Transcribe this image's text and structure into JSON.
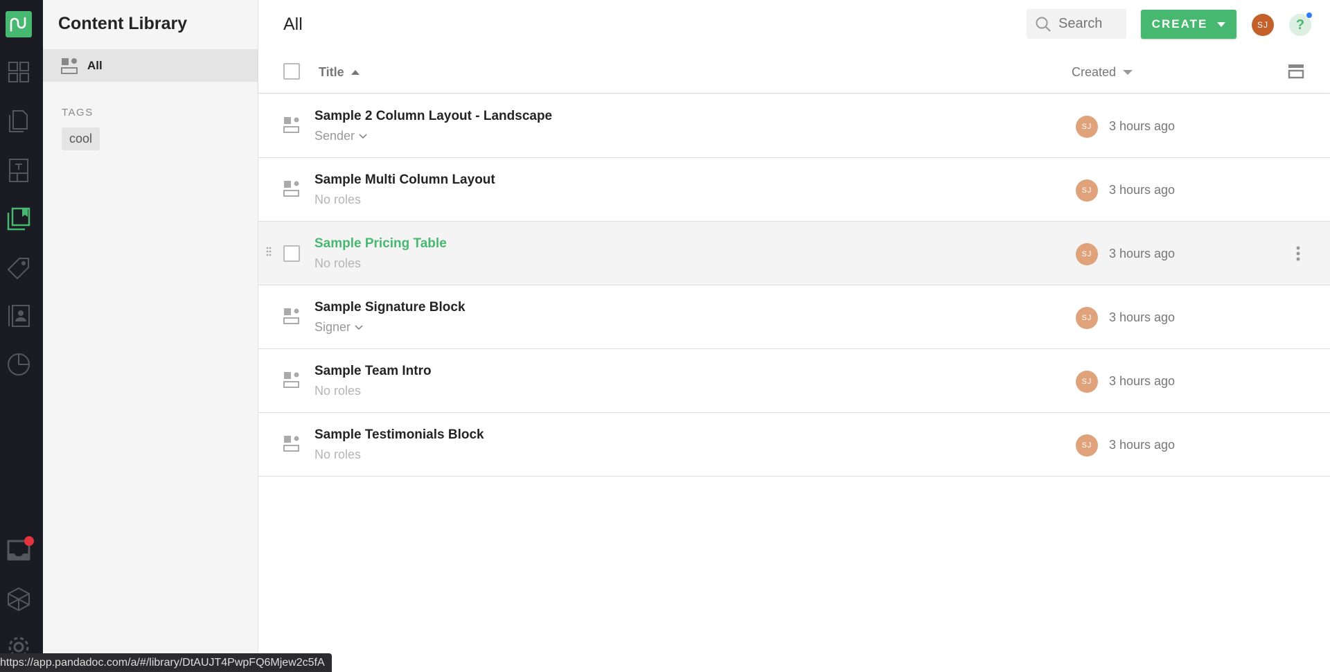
{
  "rail": {
    "items": [
      {
        "icon": "dashboard-icon"
      },
      {
        "icon": "documents-icon"
      },
      {
        "icon": "templates-icon"
      },
      {
        "icon": "content-library-icon",
        "active": true
      },
      {
        "icon": "catalog-icon"
      },
      {
        "icon": "contacts-icon"
      },
      {
        "icon": "reports-icon"
      },
      {
        "icon": "inbox-icon",
        "badge": true
      },
      {
        "icon": "integrations-icon"
      },
      {
        "icon": "settings-icon"
      }
    ],
    "active_color": "#47b870"
  },
  "sidebar": {
    "title": "Content Library",
    "all_label": "All",
    "tags_heading": "TAGS",
    "tags": [
      "cool"
    ]
  },
  "header": {
    "title": "All",
    "search_placeholder": "Search",
    "create_label": "CREATE",
    "user_initials": "SJ",
    "help_label": "?"
  },
  "table": {
    "title_col": "Title",
    "created_col": "Created",
    "rows": [
      {
        "title": "Sample 2 Column Layout - Landscape",
        "roles": "Sender",
        "has_dropdown": true,
        "owner": "SJ",
        "created": "3 hours ago"
      },
      {
        "title": "Sample Multi Column Layout",
        "roles": "No roles",
        "has_dropdown": false,
        "owner": "SJ",
        "created": "3 hours ago"
      },
      {
        "title": "Sample Pricing Table",
        "roles": "No roles",
        "has_dropdown": false,
        "owner": "SJ",
        "created": "3 hours ago",
        "hovered": true
      },
      {
        "title": "Sample Signature Block",
        "roles": "Signer",
        "has_dropdown": true,
        "owner": "SJ",
        "created": "3 hours ago"
      },
      {
        "title": "Sample Team Intro",
        "roles": "No roles",
        "has_dropdown": false,
        "owner": "SJ",
        "created": "3 hours ago"
      },
      {
        "title": "Sample Testimonials Block",
        "roles": "No roles",
        "has_dropdown": false,
        "owner": "SJ",
        "created": "3 hours ago"
      }
    ]
  },
  "status_url": "https://app.pandadoc.com/a/#/library/DtAUJT4PwpFQ6Mjew2c5fA"
}
